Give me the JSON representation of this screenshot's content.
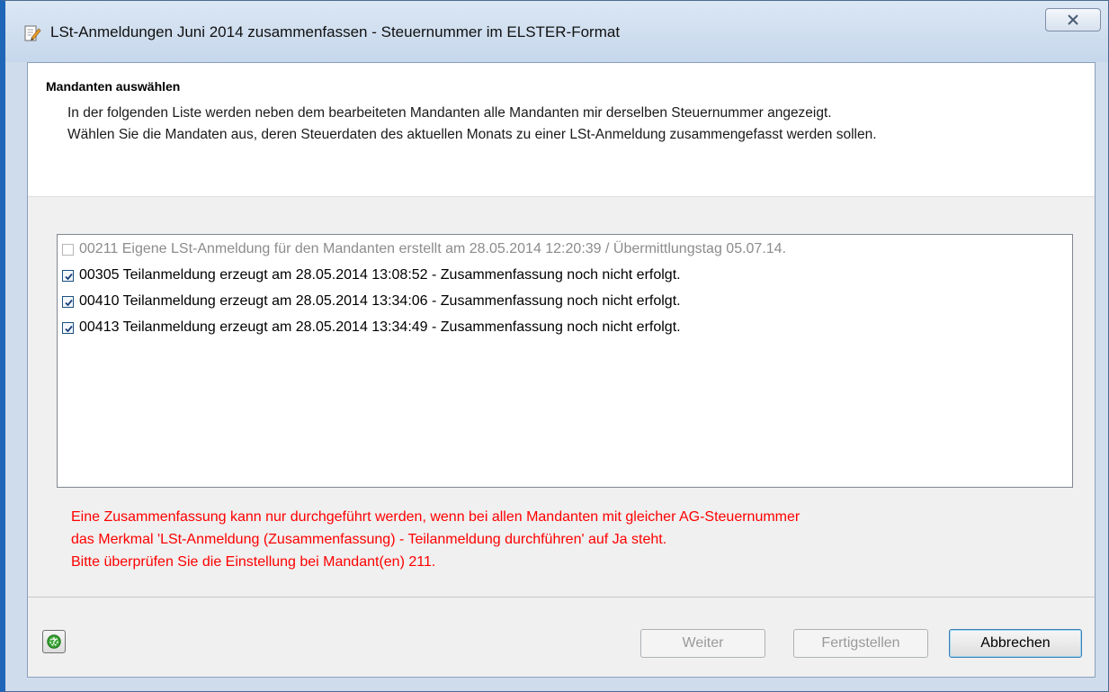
{
  "window": {
    "title": "LSt-Anmeldungen Juni 2014 zusammenfassen - Steuernummer im ELSTER-Format",
    "title_icon": "edit-document-icon",
    "close_icon": "close-icon"
  },
  "header": {
    "section_title": "Mandanten auswählen",
    "description_line1": "In der folgenden Liste werden neben dem bearbeiteten Mandanten alle Mandanten mir derselben Steuernummer angezeigt.",
    "description_line2": "Wählen Sie die Mandaten aus, deren Steuerdaten des aktuellen Monats zu einer LSt-Anmeldung zusammengefasst werden sollen."
  },
  "list": {
    "items": [
      {
        "label": "00211 Eigene LSt-Anmeldung für den Mandanten erstellt am 28.05.2014 12:20:39 / Übermittlungstag 05.07.14.",
        "checked": false,
        "enabled": false
      },
      {
        "label": "00305 Teilanmeldung erzeugt am 28.05.2014 13:08:52 - Zusammenfassung noch nicht erfolgt.",
        "checked": true,
        "enabled": true
      },
      {
        "label": "00410 Teilanmeldung erzeugt am 28.05.2014 13:34:06 - Zusammenfassung noch nicht erfolgt.",
        "checked": true,
        "enabled": true
      },
      {
        "label": "00413 Teilanmeldung erzeugt am 28.05.2014 13:34:49 - Zusammenfassung noch nicht erfolgt.",
        "checked": true,
        "enabled": true
      }
    ]
  },
  "error": {
    "line1": "Eine Zusammenfassung kann nur durchgeführt werden, wenn bei allen Mandanten mit gleicher AG-Steuernummer",
    "line2": "das Merkmal 'LSt-Anmeldung (Zusammenfassung) - Teilanmeldung durchführen' auf Ja steht.",
    "line3": "Bitte überprüfen Sie die Einstellung bei Mandant(en) 211.",
    "color": "#ff0000"
  },
  "footer": {
    "help_icon": "help-icon",
    "weiter_label": "Weiter",
    "fertigstellen_label": "Fertigstellen",
    "abbrechen_label": "Abbrechen"
  }
}
